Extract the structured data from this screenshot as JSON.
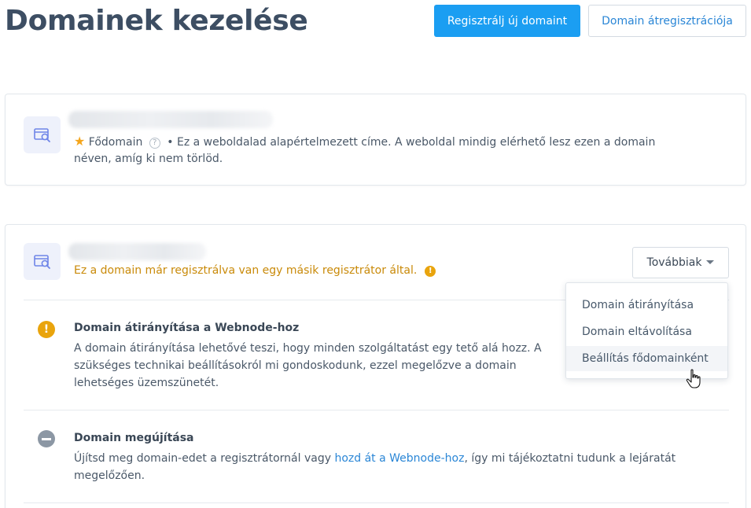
{
  "header": {
    "title": "Domainek kezelése",
    "register_button": "Regisztrálj új domaint",
    "transfer_button": "Domain átregisztrációja"
  },
  "primary_domain_card": {
    "domain_name": "",
    "badge_label": "Fődomain",
    "badge_icon": "star-icon",
    "description_line1": "• Ez a weboldalad alapértelmezett címe. A weboldal mindig elérhető lesz ezen a domain",
    "description_line2": "néven, amíg ki nem törlöd."
  },
  "second_domain_card": {
    "domain_name": "",
    "warning_text": "Ez a domain már regisztrálva van egy másik regisztrátor által.",
    "more_button": "Továbbiak",
    "rows": [
      {
        "title": "Domain átirányítása a Webnode-hoz",
        "text_line1": "A domain átirányítása lehetővé teszi, hogy minden szolgáltatást egy tető alá hozz. A",
        "text_line2": "szükséges technikai beállításokról mi gondoskodunk, ezzel megelőzve a domain",
        "text_line3": "lehetséges üzemszünetét."
      },
      {
        "title": "Domain megújítása",
        "text_before_link": "Újítsd meg domain-edet a regisztrátornál vagy ",
        "link_text": "hozd át a Webnode-hoz",
        "text_after_link": ", így mi tájékoztatni tudunk a lejáratát",
        "text_line2": "megelőzően."
      }
    ]
  },
  "dropdown_menu": {
    "items": [
      {
        "label": "Domain átirányítása"
      },
      {
        "label": "Domain eltávolítása"
      },
      {
        "label": "Beállítás fődomainként"
      }
    ],
    "hovered_index": 2
  },
  "colors": {
    "primary_blue": "#1b9ef2",
    "link_blue": "#2a86d6",
    "warning_orange": "#e9a40d",
    "title_dark": "#3d4e63"
  }
}
